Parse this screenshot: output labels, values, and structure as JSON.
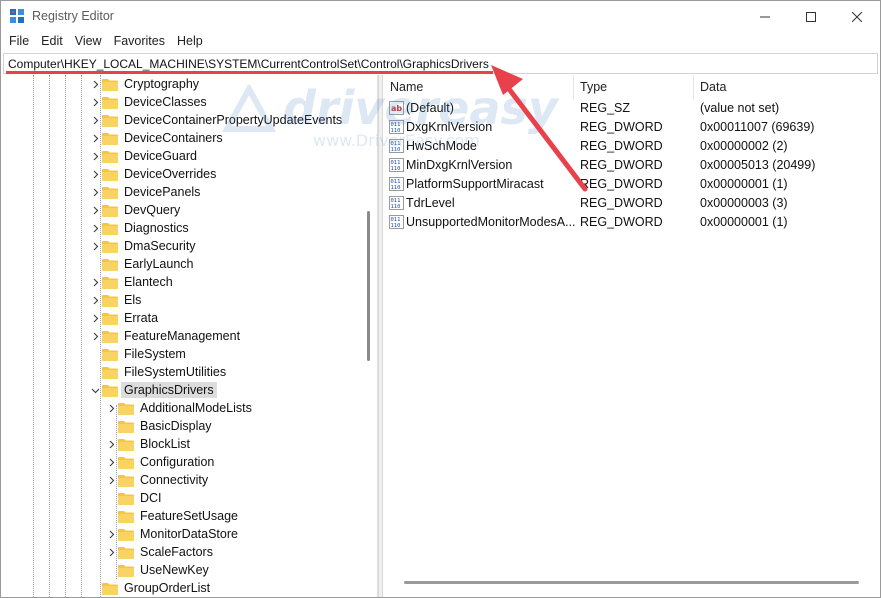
{
  "window": {
    "title": "Registry Editor",
    "controls": {
      "minimize": "minimize",
      "maximize": "maximize",
      "close": "close"
    }
  },
  "menu": [
    "File",
    "Edit",
    "View",
    "Favorites",
    "Help"
  ],
  "address": {
    "path": "Computer\\HKEY_LOCAL_MACHINE\\SYSTEM\\CurrentControlSet\\Control\\GraphicsDrivers"
  },
  "tree": {
    "items": [
      {
        "label": "Cryptography",
        "expandable": true,
        "level": 1
      },
      {
        "label": "DeviceClasses",
        "expandable": true,
        "level": 1
      },
      {
        "label": "DeviceContainerPropertyUpdateEvents",
        "expandable": true,
        "level": 1
      },
      {
        "label": "DeviceContainers",
        "expandable": true,
        "level": 1
      },
      {
        "label": "DeviceGuard",
        "expandable": true,
        "level": 1
      },
      {
        "label": "DeviceOverrides",
        "expandable": true,
        "level": 1
      },
      {
        "label": "DevicePanels",
        "expandable": true,
        "level": 1
      },
      {
        "label": "DevQuery",
        "expandable": true,
        "level": 1
      },
      {
        "label": "Diagnostics",
        "expandable": true,
        "level": 1
      },
      {
        "label": "DmaSecurity",
        "expandable": true,
        "level": 1
      },
      {
        "label": "EarlyLaunch",
        "expandable": false,
        "level": 1
      },
      {
        "label": "Elantech",
        "expandable": true,
        "level": 1
      },
      {
        "label": "Els",
        "expandable": true,
        "level": 1
      },
      {
        "label": "Errata",
        "expandable": true,
        "level": 1
      },
      {
        "label": "FeatureManagement",
        "expandable": true,
        "level": 1
      },
      {
        "label": "FileSystem",
        "expandable": false,
        "level": 1
      },
      {
        "label": "FileSystemUtilities",
        "expandable": false,
        "level": 1
      },
      {
        "label": "GraphicsDrivers",
        "expandable": true,
        "expanded": true,
        "selected": true,
        "level": 1
      },
      {
        "label": "AdditionalModeLists",
        "expandable": true,
        "level": 2
      },
      {
        "label": "BasicDisplay",
        "expandable": false,
        "level": 2
      },
      {
        "label": "BlockList",
        "expandable": true,
        "level": 2
      },
      {
        "label": "Configuration",
        "expandable": true,
        "level": 2
      },
      {
        "label": "Connectivity",
        "expandable": true,
        "level": 2
      },
      {
        "label": "DCI",
        "expandable": false,
        "level": 2
      },
      {
        "label": "FeatureSetUsage",
        "expandable": false,
        "level": 2
      },
      {
        "label": "MonitorDataStore",
        "expandable": true,
        "level": 2
      },
      {
        "label": "ScaleFactors",
        "expandable": true,
        "level": 2
      },
      {
        "label": "UseNewKey",
        "expandable": false,
        "level": 2
      },
      {
        "label": "GroupOrderList",
        "expandable": false,
        "level": 1
      }
    ]
  },
  "values": {
    "columns": {
      "name": "Name",
      "type": "Type",
      "data": "Data"
    },
    "rows": [
      {
        "name": "(Default)",
        "type": "REG_SZ",
        "data": "(value not set)",
        "icon": "string-value-icon"
      },
      {
        "name": "DxgKrnlVersion",
        "type": "REG_DWORD",
        "data": "0x00011007 (69639)",
        "icon": "binary-value-icon"
      },
      {
        "name": "HwSchMode",
        "type": "REG_DWORD",
        "data": "0x00000002 (2)",
        "icon": "binary-value-icon"
      },
      {
        "name": "MinDxgKrnlVersion",
        "type": "REG_DWORD",
        "data": "0x00005013 (20499)",
        "icon": "binary-value-icon"
      },
      {
        "name": "PlatformSupportMiracast",
        "type": "REG_DWORD",
        "data": "0x00000001 (1)",
        "icon": "binary-value-icon"
      },
      {
        "name": "TdrLevel",
        "type": "REG_DWORD",
        "data": "0x00000003 (3)",
        "icon": "binary-value-icon"
      },
      {
        "name": "UnsupportedMonitorModesA...",
        "type": "REG_DWORD",
        "data": "0x00000001 (1)",
        "icon": "binary-value-icon"
      }
    ]
  },
  "watermark": {
    "brand": "drivereasy",
    "site": "www.DriverEasy.com"
  },
  "colors": {
    "annotation": "#e8414b",
    "folder": "#f4c542",
    "selection": "#dcdcdc"
  }
}
